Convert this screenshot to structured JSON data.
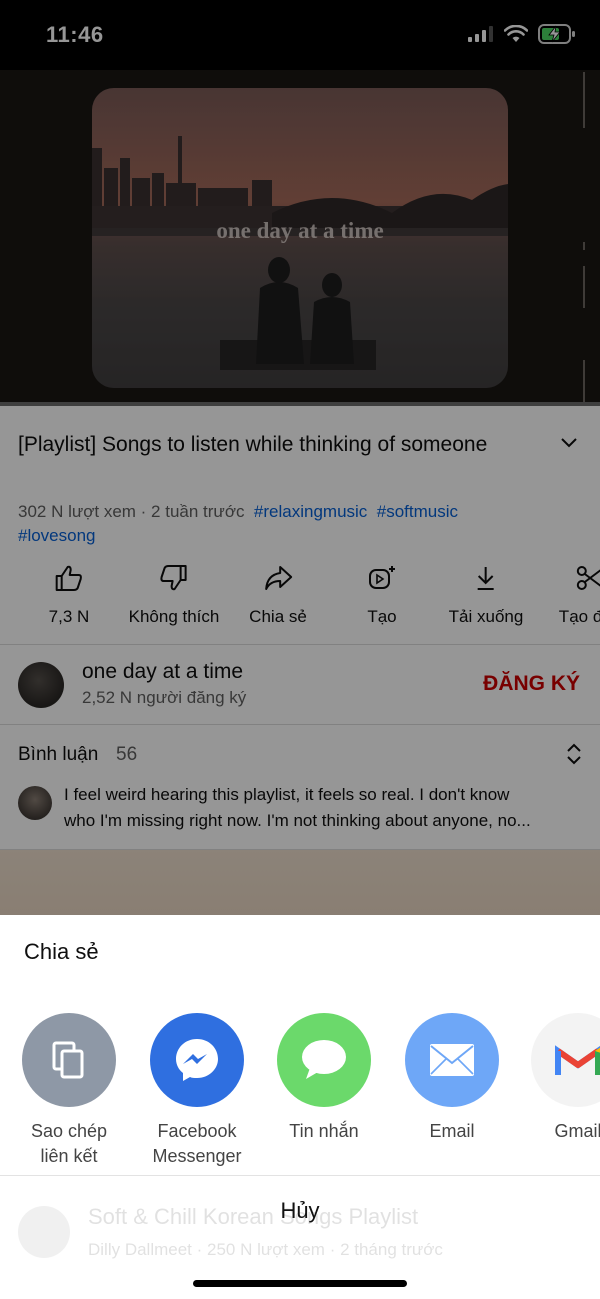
{
  "status_bar": {
    "time": "11:46"
  },
  "video": {
    "overlay_title": "one day at a time"
  },
  "details": {
    "title": "[Playlist] Songs to listen while thinking of someone",
    "meta": "302 N lượt xem · 2 tuần trước",
    "hashtags": [
      "#relaxingmusic",
      "#softmusic",
      "#lovesong"
    ]
  },
  "actions": [
    {
      "label": "7,3 N",
      "icon": "thumbs-up-icon"
    },
    {
      "label": "Không thích",
      "icon": "thumbs-down-icon"
    },
    {
      "label": "Chia sẻ",
      "icon": "share-icon"
    },
    {
      "label": "Tạo",
      "icon": "create-icon"
    },
    {
      "label": "Tải xuống",
      "icon": "download-icon"
    },
    {
      "label": "Tạo đoạ",
      "icon": "scissors-icon"
    }
  ],
  "channel": {
    "name": "one day at a time",
    "subscribers": "2,52 N người đăng ký",
    "subscribe_label": "ĐĂNG KÝ"
  },
  "comments": {
    "label": "Bình luận",
    "count": "56",
    "top_comment_lines": [
      "I feel weird hearing this playlist, it feels so real. I don't know",
      "who I'm missing right now. I'm not thinking about anyone, no..."
    ]
  },
  "share_sheet": {
    "title": "Chia sẻ",
    "targets": [
      {
        "label_lines": [
          "Sao chép",
          "liên kết"
        ],
        "icon": "copy-link-icon",
        "color": "#8e98a6"
      },
      {
        "label_lines": [
          "Facebook",
          "Messenger"
        ],
        "icon": "messenger-icon",
        "color": "#2f6fe0"
      },
      {
        "label_lines": [
          "Tin nhắn",
          ""
        ],
        "icon": "messages-icon",
        "color": "#6bd96b"
      },
      {
        "label_lines": [
          "Email",
          ""
        ],
        "icon": "email-icon",
        "color": "#6ea7f7"
      },
      {
        "label_lines": [
          "Gmail",
          ""
        ],
        "icon": "gmail-icon",
        "color": "#f1f1f1"
      }
    ],
    "cancel_label": "Hủy"
  },
  "background_list_item": {
    "title": "Soft & Chill Korean Songs Playlist",
    "meta": "Dilly Dallmeet · 250 N lượt xem · 2 tháng trước"
  },
  "colors": {
    "subscribe": "#cc0000",
    "hashtag": "#065fd4",
    "share_sheet_bg": "#ffffff"
  }
}
